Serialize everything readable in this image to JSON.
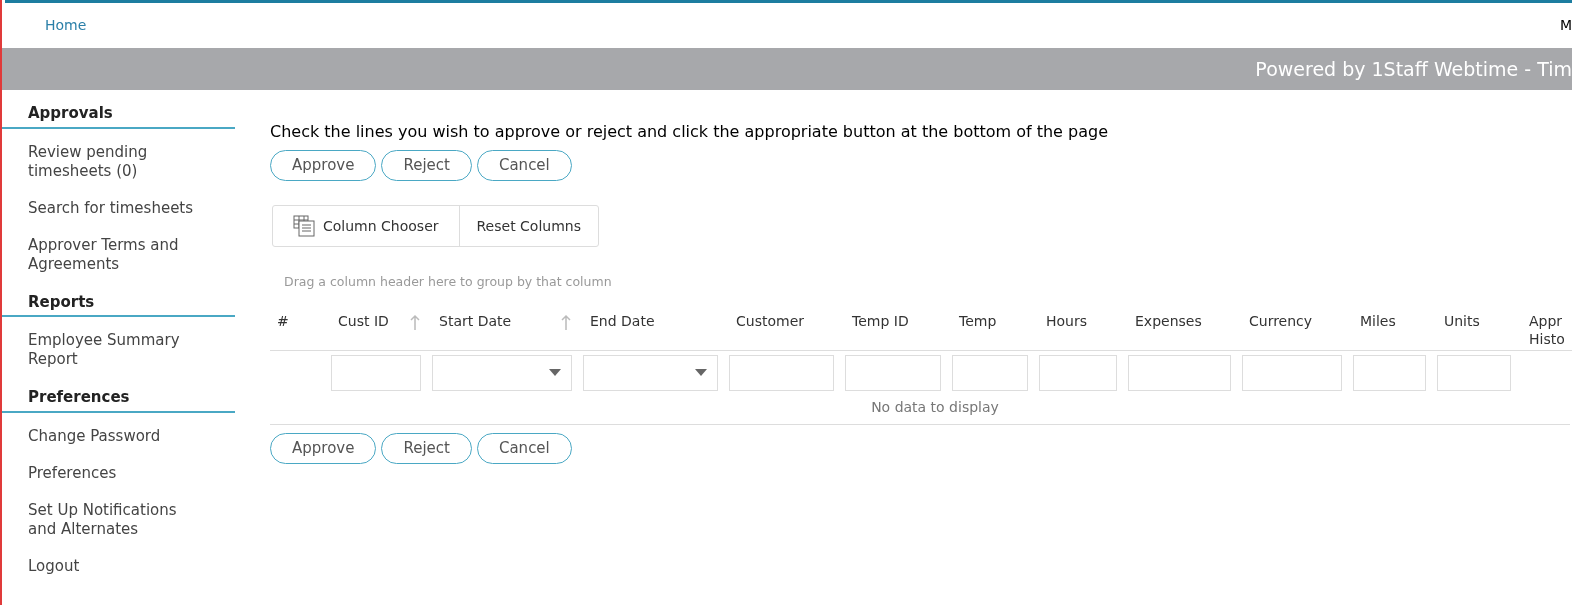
{
  "top_nav": {
    "home_link": "Home",
    "user_initial": "M"
  },
  "banner": {
    "text": "Powered by 1Staff Webtime - Tim"
  },
  "sidebar": {
    "sections": [
      {
        "title": "Approvals",
        "items": [
          "Review pending timesheets (0)",
          "Search for timesheets",
          "Approver Terms and Agreements"
        ]
      },
      {
        "title": "Reports",
        "items": [
          "Employee Summary Report"
        ]
      },
      {
        "title": "Preferences",
        "items": [
          "Change Password",
          "Preferences",
          "Set Up Notifications and Alternates",
          "Logout"
        ]
      }
    ]
  },
  "instructions": "Check the lines you wish to approve or reject and click the appropriate button at the bottom of the page",
  "top_buttons": [
    "Approve",
    "Reject",
    "Cancel"
  ],
  "grid_toolbar": {
    "column_chooser": "Column Chooser",
    "reset_columns": "Reset Columns"
  },
  "group_panel": {
    "hint": "Drag a column header here to group by that column"
  },
  "table": {
    "columns": [
      {
        "label": "#",
        "kind": "plain",
        "sorted": false
      },
      {
        "label": "Cust ID",
        "kind": "text",
        "sorted": true
      },
      {
        "label": "Start Date",
        "kind": "dropdown",
        "sorted": true
      },
      {
        "label": "End Date",
        "kind": "dropdown",
        "sorted": false
      },
      {
        "label": "Customer",
        "kind": "text",
        "sorted": false
      },
      {
        "label": "Temp ID",
        "kind": "text",
        "sorted": false
      },
      {
        "label": "Temp",
        "kind": "text",
        "sorted": false
      },
      {
        "label": "Hours",
        "kind": "text",
        "sorted": false
      },
      {
        "label": "Expenses",
        "kind": "text",
        "sorted": false
      },
      {
        "label": "Currency",
        "kind": "text",
        "sorted": false
      },
      {
        "label": "Miles",
        "kind": "text",
        "sorted": false
      },
      {
        "label": "Units",
        "kind": "text",
        "sorted": false
      },
      {
        "label": "Appr Histo",
        "kind": "plain",
        "sorted": false
      }
    ],
    "empty_message": "No data to display"
  },
  "bottom_buttons": [
    "Approve",
    "Reject",
    "Cancel"
  ]
}
